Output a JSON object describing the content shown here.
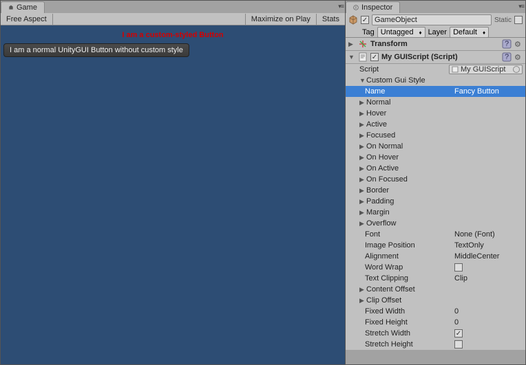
{
  "game": {
    "tab": "Game",
    "aspect": "Free Aspect",
    "maximize": "Maximize on Play",
    "stats": "Stats",
    "fancy_btn": "I am a custom-styled Button",
    "normal_btn": "I am a normal UnityGUI Button without custom style"
  },
  "insp": {
    "tab": "Inspector",
    "go_name": "GameObject",
    "static": "Static",
    "tag_lbl": "Tag",
    "tag_val": "Untagged",
    "layer_lbl": "Layer",
    "layer_val": "Default",
    "transform": "Transform",
    "script_comp": "My GUIScript (Script)",
    "script_lbl": "Script",
    "script_val": "My GUIScript",
    "custom_style": "Custom Gui Style",
    "name_lbl": "Name",
    "name_val": "Fancy Button",
    "states": [
      "Normal",
      "Hover",
      "Active",
      "Focused",
      "On Normal",
      "On Hover",
      "On Active",
      "On Focused",
      "Border",
      "Padding",
      "Margin",
      "Overflow"
    ],
    "font_lbl": "Font",
    "font_val": "None (Font)",
    "imgpos_lbl": "Image Position",
    "imgpos_val": "TextOnly",
    "align_lbl": "Alignment",
    "align_val": "MiddleCenter",
    "wrap_lbl": "Word Wrap",
    "clip_lbl": "Text Clipping",
    "clip_val": "Clip",
    "content_offset": "Content Offset",
    "clip_offset": "Clip Offset",
    "fw_lbl": "Fixed Width",
    "fw_val": "0",
    "fh_lbl": "Fixed Height",
    "fh_val": "0",
    "sw_lbl": "Stretch Width",
    "sh_lbl": "Stretch Height"
  }
}
